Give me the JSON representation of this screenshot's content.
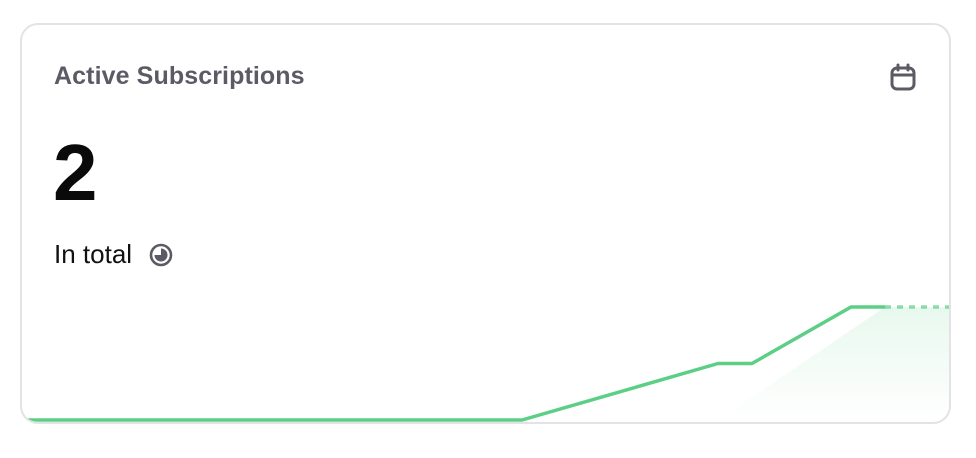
{
  "card": {
    "title": "Active Subscriptions",
    "value": "2",
    "subtitle": "In total"
  },
  "icons": {
    "calendar": "calendar-icon",
    "info": "clock-pie-icon"
  },
  "colors": {
    "line": "#5ccf86",
    "title": "#5b5b66",
    "value": "#0a0a0a",
    "border": "#e3e3e6"
  },
  "chart_data": {
    "type": "line",
    "series": [
      {
        "values": [
          0,
          0,
          0,
          0,
          0,
          0,
          1,
          1,
          2,
          2
        ]
      }
    ],
    "grid": false,
    "last_segment_style": "dashed"
  }
}
